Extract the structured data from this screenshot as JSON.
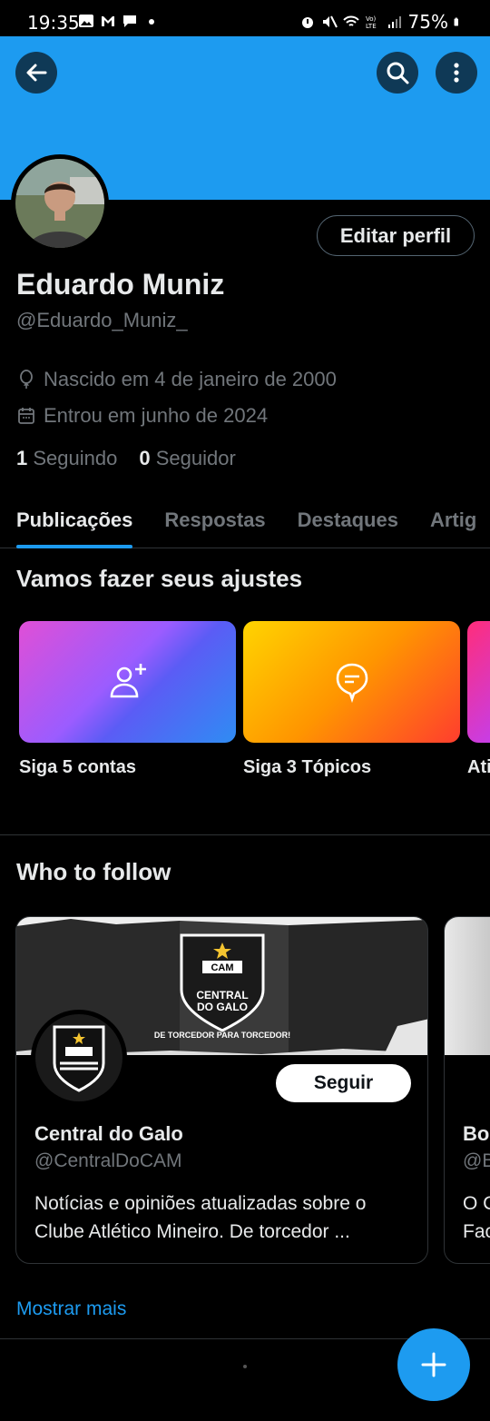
{
  "status_bar": {
    "time": "19:35",
    "battery": "75%"
  },
  "profile": {
    "name": "Eduardo Muniz",
    "handle": "@Eduardo_Muniz_",
    "edit_label": "Editar perfil",
    "birth": "Nascido em 4 de janeiro de 2000",
    "joined": "Entrou em junho de 2024",
    "following_count": "1",
    "following_label": "Seguindo",
    "followers_count": "0",
    "followers_label": "Seguidor"
  },
  "tabs": [
    {
      "label": "Publicações",
      "active": true
    },
    {
      "label": "Respostas",
      "active": false
    },
    {
      "label": "Destaques",
      "active": false
    },
    {
      "label": "Artig",
      "active": false
    }
  ],
  "setup": {
    "title": "Vamos fazer seus ajustes",
    "tiles": [
      {
        "label": "Siga 5 contas",
        "icon": "add-user-icon"
      },
      {
        "label": "Siga 3 Tópicos",
        "icon": "topic-icon"
      },
      {
        "label": "Ati",
        "icon": ""
      }
    ]
  },
  "who_to_follow": {
    "title": "Who to follow",
    "card": {
      "name": "Central do Galo",
      "handle": "@CentralDoCAM",
      "bio": "Notícias e opiniões atualizadas sobre o Clube Atlético Mineiro. De torcedor ...",
      "follow_label": "Seguir",
      "banner_text_1": "CENTRAL",
      "banner_text_2": "DO GALO",
      "banner_slogan": "DE TORCEDOR PARA TORCEDOR!",
      "crest_text": "CAM"
    },
    "card2_peek": {
      "name": "Bo",
      "handle": "@B",
      "bio_1": "O C",
      "bio_2": "Fac"
    },
    "show_more": "Mostrar mais"
  },
  "colors": {
    "accent": "#1d9bf0",
    "background": "#000000",
    "muted": "#71767b"
  }
}
